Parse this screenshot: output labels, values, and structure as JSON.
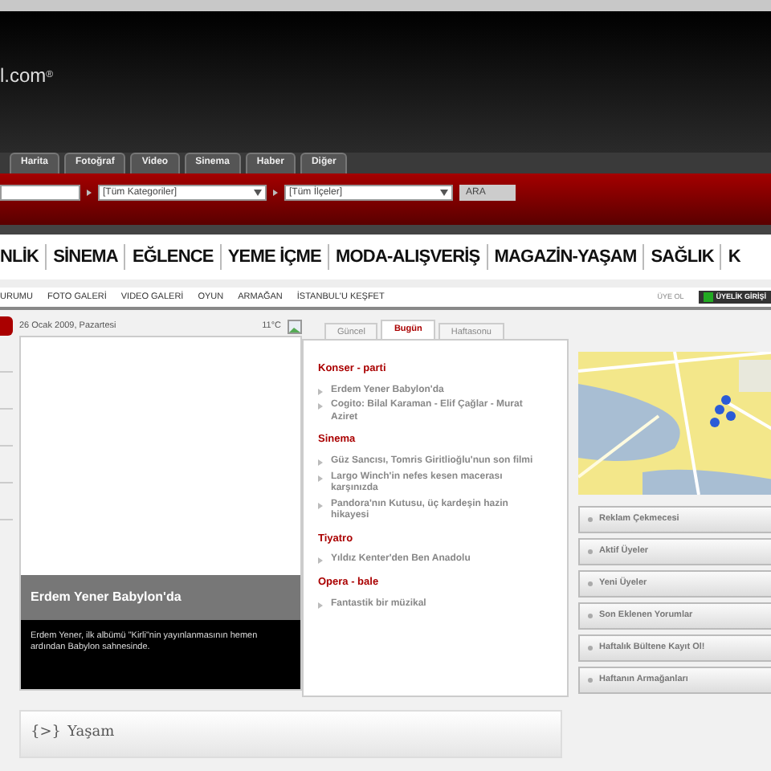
{
  "header": {
    "logo": "l.com",
    "logo_mark": "®"
  },
  "tabs": [
    {
      "label": "Harita",
      "selected": false
    },
    {
      "label": "Fotoğraf",
      "selected": false
    },
    {
      "label": "Video",
      "selected": false
    },
    {
      "label": "Sinema",
      "selected": false
    },
    {
      "label": "Haber",
      "selected": false
    },
    {
      "label": "Diğer",
      "selected": false
    }
  ],
  "search": {
    "categories": "[Tüm Kategoriler]",
    "districts": "[Tüm İlçeler]",
    "button": "ARA"
  },
  "categories": [
    "NLİK",
    "SİNEMA",
    "EĞLENCE",
    "YEME İÇME",
    "MODA-ALIŞVERİŞ",
    "MAGAZİN-YAŞAM",
    "SAĞLIK",
    "K"
  ],
  "subnav": [
    "URUMU",
    "FOTO GALERİ",
    "VIDEO GALERİ",
    "OYUN",
    "ARMAĞAN",
    "İSTANBUL'U KEŞFET"
  ],
  "signup": "ÜYE OL",
  "login": "ÜYELİK GİRİŞİ",
  "date": "26 Ocak 2009, Pazartesi",
  "temperature": "11°C",
  "feature": {
    "title": "Erdem Yener Babylon'da",
    "text": "Erdem Yener, ilk albümü \"Kirli\"nin yayınlanmasının hemen ardından Babylon sahnesinde."
  },
  "events_tabs": [
    {
      "label": "Güncel",
      "selected": false
    },
    {
      "label": "Bugün",
      "selected": true
    },
    {
      "label": "Haftasonu",
      "selected": false
    }
  ],
  "events": [
    {
      "heading": "Konser - parti",
      "items": [
        "Erdem Yener Babylon'da",
        "Cogito: Bilal Karaman - Elif Çağlar - Murat Aziret"
      ]
    },
    {
      "heading": "Sinema",
      "items": [
        "Güz Sancısı, Tomris Giritlioğlu'nun son filmi",
        "Largo Winch'in nefes kesen macerası karşınızda",
        "Pandora'nın Kutusu, üç kardeşin hazin hikayesi"
      ]
    },
    {
      "heading": "Tiyatro",
      "items": [
        "Yıldız Kenter'den Ben Anadolu"
      ]
    },
    {
      "heading": "Opera - bale",
      "items": [
        "Fantastik bir müzikal"
      ]
    }
  ],
  "section": {
    "icon": "{>}",
    "title": "Yaşam"
  },
  "side_panels": [
    "Reklam Çekmecesi",
    "Aktif Üyeler",
    "Yeni Üyeler",
    "Son Eklenen Yorumlar",
    "Haftalık Bültene Kayıt Ol!",
    "Haftanın Armağanları"
  ]
}
